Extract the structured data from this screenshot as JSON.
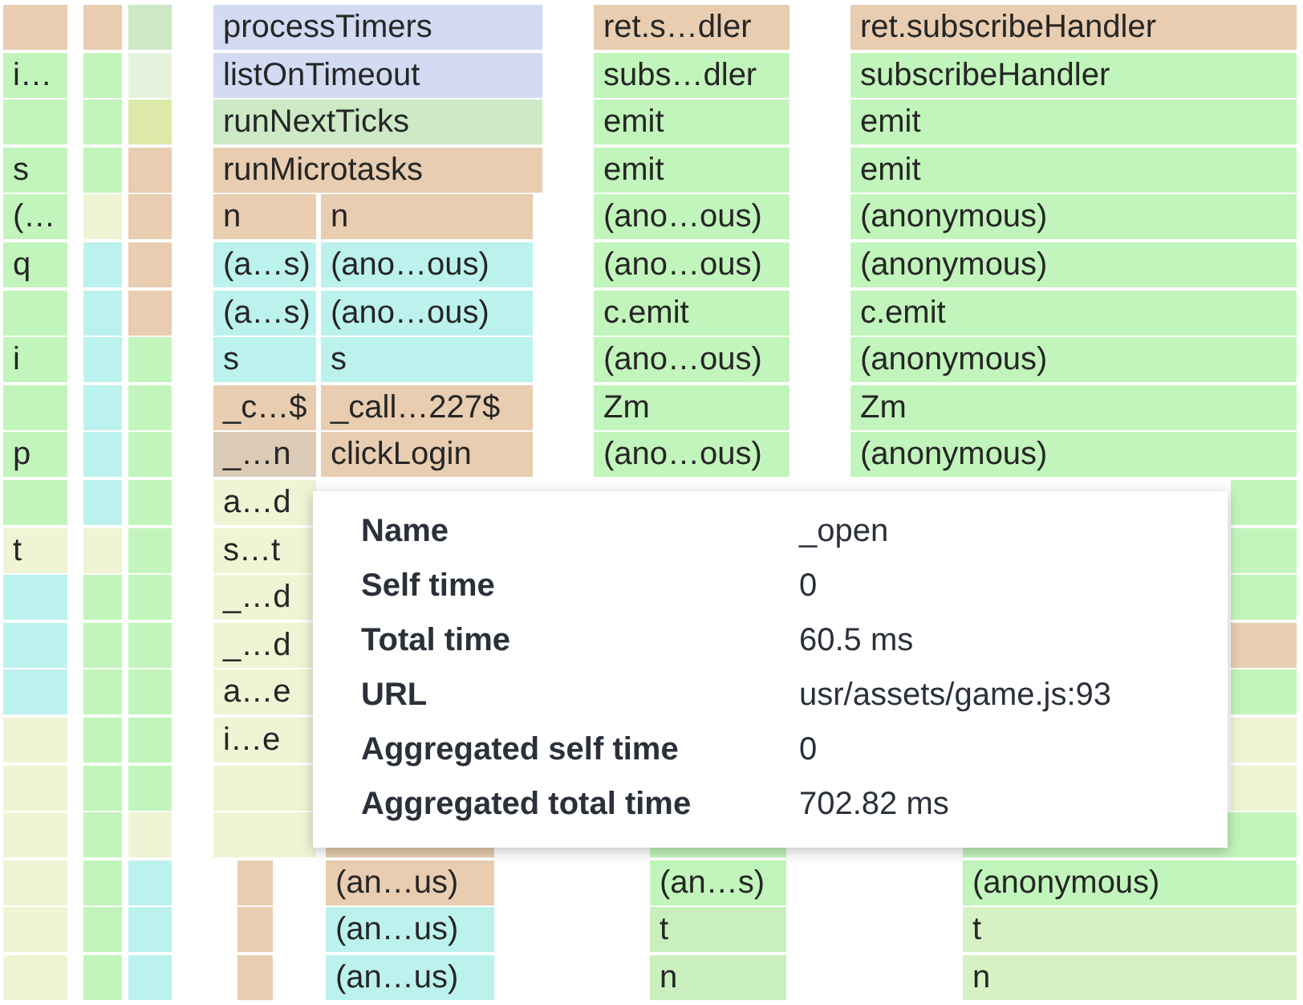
{
  "flame_rows": [
    {
      "frames": [
        {
          "color": "#e8cdb0"
        },
        {
          "color": "#e8cdb0"
        },
        {
          "color": "#cde9c6"
        },
        {
          "label": "processTimers",
          "color": "#d3dbf3"
        },
        {
          "label": "ret.s…dler",
          "color": "#e8cdb0"
        },
        {
          "label": "ret.subscribeHandler",
          "color": "#e8cdb0"
        }
      ]
    },
    {
      "frames": [
        {
          "label": "i…",
          "color": "#c2f5bb"
        },
        {
          "color": "#c2f5bb"
        },
        {
          "color": "#e6f3dc"
        },
        {
          "label": "listOnTimeout",
          "color": "#d3dbf3"
        },
        {
          "label": "subs…dler",
          "color": "#c2f5bb"
        },
        {
          "label": "subscribeHandler",
          "color": "#c2f5bb"
        }
      ]
    },
    {
      "frames": [
        {
          "color": "#c2f5bb"
        },
        {
          "color": "#c2f5bb"
        },
        {
          "color": "#dce9a8"
        },
        {
          "label": "runNextTicks",
          "color": "#cde9c6"
        },
        {
          "label": "emit",
          "color": "#c2f5bb"
        },
        {
          "label": "emit",
          "color": "#c2f5bb"
        }
      ]
    },
    {
      "frames": [
        {
          "label": "s",
          "color": "#c2f5bb"
        },
        {
          "color": "#c2f5bb"
        },
        {
          "color": "#e8cdb0"
        },
        {
          "label": "runMicrotasks",
          "color": "#e8cdb0"
        },
        {
          "label": "emit",
          "color": "#c2f5bb"
        },
        {
          "label": "emit",
          "color": "#c2f5bb"
        }
      ]
    },
    {
      "frames": [
        {
          "label": "(…",
          "color": "#c2f5bb"
        },
        {
          "color": "#eff5d4"
        },
        {
          "color": "#e8cdb0"
        },
        {
          "label": "n",
          "color": "#e8cdb0"
        },
        {
          "label": "n",
          "color": "#e8cdb0"
        },
        {
          "label": "(ano…ous)",
          "color": "#c2f5bb"
        },
        {
          "label": "(anonymous)",
          "color": "#c2f5bb"
        }
      ]
    },
    {
      "frames": [
        {
          "label": "q",
          "color": "#c2f5bb"
        },
        {
          "color": "#bcf2ee"
        },
        {
          "color": "#e8cdb0"
        },
        {
          "label": "(a…s)",
          "color": "#bcf2ee"
        },
        {
          "label": "(ano…ous)",
          "color": "#bcf2ee"
        },
        {
          "label": "(ano…ous)",
          "color": "#c2f5bb"
        },
        {
          "label": "(anonymous)",
          "color": "#c2f5bb"
        }
      ]
    },
    {
      "frames": [
        {
          "color": "#c2f5bb"
        },
        {
          "color": "#bcf2ee"
        },
        {
          "color": "#e8cdb0"
        },
        {
          "label": "(a…s)",
          "color": "#bcf2ee"
        },
        {
          "label": "(ano…ous)",
          "color": "#bcf2ee"
        },
        {
          "label": "c.emit",
          "color": "#c2f5bb"
        },
        {
          "label": "c.emit",
          "color": "#c2f5bb"
        }
      ]
    },
    {
      "frames": [
        {
          "label": "i",
          "color": "#c2f5bb"
        },
        {
          "color": "#bcf2ee"
        },
        {
          "color": "#c2f5bb"
        },
        {
          "label": "s",
          "color": "#bcf2ee"
        },
        {
          "label": "s",
          "color": "#bcf2ee"
        },
        {
          "label": "(ano…ous)",
          "color": "#c2f5bb"
        },
        {
          "label": "(anonymous)",
          "color": "#c2f5bb"
        }
      ]
    },
    {
      "frames": [
        {
          "color": "#c2f5bb"
        },
        {
          "color": "#bcf2ee"
        },
        {
          "color": "#c2f5bb"
        },
        {
          "label": "_c…$",
          "color": "#e8cdb0"
        },
        {
          "label": "_call…227$",
          "color": "#e8cdb0"
        },
        {
          "label": "Zm",
          "color": "#c2f5bb"
        },
        {
          "label": "Zm",
          "color": "#c2f5bb"
        }
      ]
    },
    {
      "frames": [
        {
          "label": "p",
          "color": "#c2f5bb"
        },
        {
          "color": "#bcf2ee"
        },
        {
          "color": "#c2f5bb"
        },
        {
          "label": "_…n",
          "color": "#dccbb6"
        },
        {
          "label": "clickLogin",
          "color": "#e8cdb0"
        },
        {
          "label": "(ano…ous)",
          "color": "#c2f5bb"
        },
        {
          "label": "(anonymous)",
          "color": "#c2f5bb"
        }
      ]
    },
    {
      "frames": [
        {
          "color": "#c2f5bb"
        },
        {
          "color": "#bcf2ee"
        },
        {
          "color": "#c2f5bb"
        },
        {
          "label": "a…d",
          "color": "#eff5d4"
        },
        {
          "color": "#c2f5bb"
        }
      ]
    },
    {
      "frames": [
        {
          "label": "t",
          "color": "#eff5d4"
        },
        {
          "color": "#eff5d4"
        },
        {
          "color": "#c2f5bb"
        },
        {
          "label": "s…t",
          "color": "#eff5d4"
        },
        {
          "color": "#c2f5bb"
        }
      ]
    },
    {
      "frames": [
        {
          "color": "#bcf2ee"
        },
        {
          "color": "#c2f5bb"
        },
        {
          "color": "#c2f5bb"
        },
        {
          "label": "_…d",
          "color": "#eff5d4"
        },
        {
          "color": "#c2f5bb"
        }
      ]
    },
    {
      "frames": [
        {
          "color": "#bcf2ee"
        },
        {
          "color": "#c2f5bb"
        },
        {
          "color": "#c2f5bb"
        },
        {
          "label": "_…d",
          "color": "#eff5d4"
        },
        {
          "color": "#e8cdb0"
        }
      ]
    },
    {
      "frames": [
        {
          "color": "#bcf2ee"
        },
        {
          "color": "#c2f5bb"
        },
        {
          "color": "#c2f5bb"
        },
        {
          "label": "a…e",
          "color": "#eff5d4"
        },
        {
          "color": "#c2f5bb"
        }
      ]
    },
    {
      "frames": [
        {
          "color": "#eff5d4"
        },
        {
          "color": "#c2f5bb"
        },
        {
          "color": "#c2f5bb"
        },
        {
          "label": "i…e",
          "color": "#eff5d4"
        },
        {
          "color": "#eff5d4"
        }
      ]
    },
    {
      "frames": [
        {
          "color": "#eff5d4"
        },
        {
          "color": "#c2f5bb"
        },
        {
          "color": "#c2f5bb"
        },
        {
          "color": "#eff5d4"
        },
        {
          "color": "#eff5d4"
        }
      ]
    },
    {
      "frames": [
        {
          "color": "#eff5d4"
        },
        {
          "color": "#c2f5bb"
        },
        {
          "color": "#eff5d4"
        },
        {
          "color": "#eff5d4"
        },
        {
          "color": "#e8cdb0"
        },
        {
          "color": "#c2f5bb"
        },
        {
          "color": "#c2f5bb"
        }
      ]
    },
    {
      "frames": [
        {
          "color": "#eff5d4"
        },
        {
          "color": "#c2f5bb"
        },
        {
          "color": "#bcf2ee"
        },
        {
          "color": "#e8cdb0"
        },
        {
          "label": "(an…us)",
          "color": "#e8cdb0"
        },
        {
          "label": "(an…s)",
          "color": "#c2f5bb"
        },
        {
          "label": "(anonymous)",
          "color": "#c2f5bb"
        }
      ]
    },
    {
      "frames": [
        {
          "color": "#eff5d4"
        },
        {
          "color": "#c2f5bb"
        },
        {
          "color": "#bcf2ee"
        },
        {
          "color": "#e8cdb0"
        },
        {
          "label": "(an…us)",
          "color": "#bcf2ee"
        },
        {
          "label": "t",
          "color": "#c8efbd"
        },
        {
          "label": "t",
          "color": "#d6f2c4"
        }
      ]
    },
    {
      "frames": [
        {
          "color": "#eff5d4"
        },
        {
          "color": "#c2f5bb"
        },
        {
          "color": "#bcf2ee"
        },
        {
          "color": "#e8cdb0"
        },
        {
          "label": "(an…us)",
          "color": "#bcf2ee"
        },
        {
          "label": "n",
          "color": "#c8efbd"
        },
        {
          "label": "n",
          "color": "#d6f2c4"
        }
      ]
    }
  ],
  "tooltip": {
    "rows": [
      {
        "label": "Name",
        "value": "_open"
      },
      {
        "label": "Self time",
        "value": "0"
      },
      {
        "label": "Total time",
        "value": "60.5 ms"
      },
      {
        "label": "URL",
        "value": "usr/assets/game.js:93"
      },
      {
        "label": "Aggregated self time",
        "value": "0"
      },
      {
        "label": "Aggregated total time",
        "value": "702.82 ms"
      }
    ]
  }
}
